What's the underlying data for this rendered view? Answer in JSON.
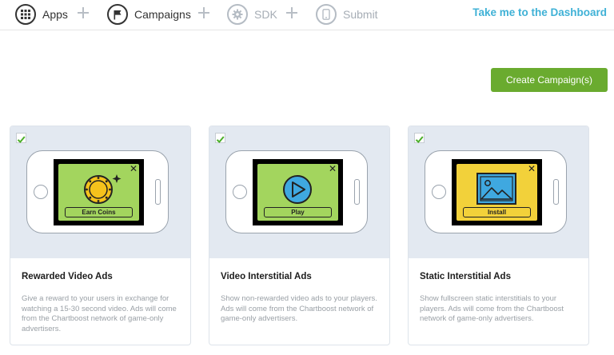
{
  "nav": {
    "steps": [
      {
        "label": "Apps",
        "icon": "grid-icon",
        "active": true
      },
      {
        "label": "Campaigns",
        "icon": "flag-icon",
        "active": true
      },
      {
        "label": "SDK",
        "icon": "gear-icon",
        "active": false
      },
      {
        "label": "Submit",
        "icon": "phone-icon",
        "active": false
      }
    ],
    "dashboard_link": "Take me to the Dashboard"
  },
  "create_button": "Create Campaign(s)",
  "colors": {
    "accent_green": "#6aab2f",
    "link_blue": "#3fb1d6",
    "check_green": "#4caf2a",
    "card_top_bg": "#e3e9f1"
  },
  "cards": [
    {
      "title": "Rewarded Video Ads",
      "description": "Give a reward to your users in exchange for watching a 15-30 second video. Ads will come from the Chartboost network of game-only advertisers.",
      "button_label": "Earn Coins",
      "icon": "coin-icon",
      "checked": true
    },
    {
      "title": "Video Interstitial Ads",
      "description": "Show non-rewarded video ads to your players. Ads will come from the Chartboost network of game-only advertisers.",
      "button_label": "Play",
      "icon": "play-icon",
      "checked": true
    },
    {
      "title": "Static Interstitial Ads",
      "description": "Show fullscreen static interstitials to your players. Ads will come from the Chartboost network of game-only advertisers.",
      "button_label": "Install",
      "icon": "image-icon",
      "checked": true
    }
  ]
}
